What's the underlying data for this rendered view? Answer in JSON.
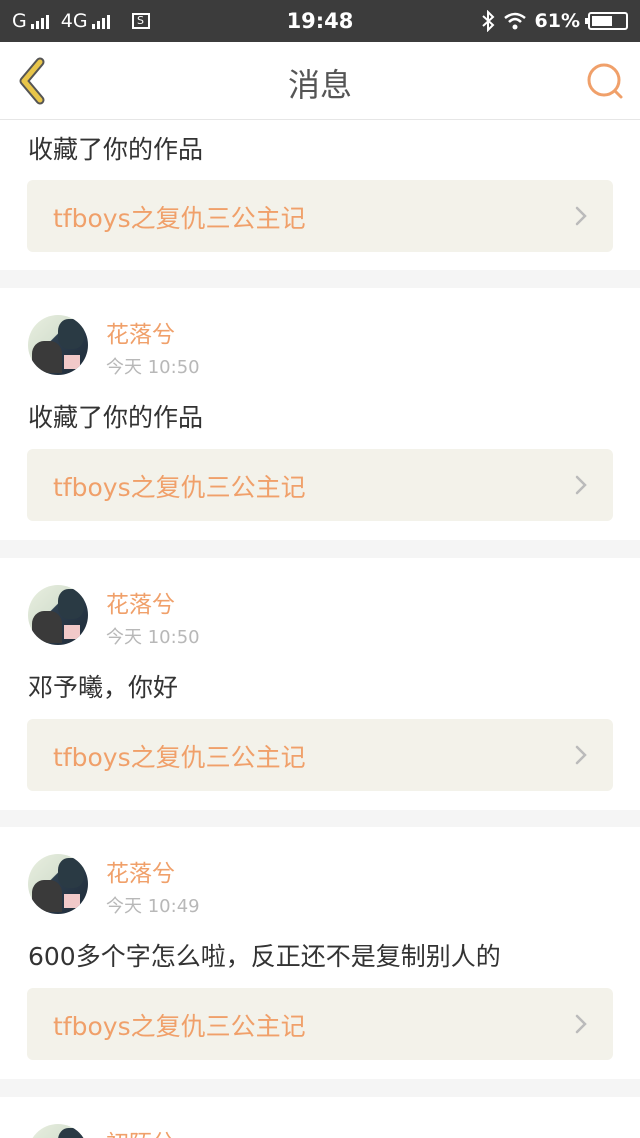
{
  "status_bar": {
    "carrier1": "G",
    "carrier2": "4G",
    "time": "19:48",
    "battery_percent": "61%",
    "battery_level": 0.61,
    "icons": [
      "signal-icon",
      "sim-icon",
      "bluetooth-icon",
      "wifi-icon",
      "battery-icon"
    ]
  },
  "nav": {
    "title": "消息",
    "back_icon": "chevron-left-icon",
    "search_icon": "search-icon"
  },
  "colors": {
    "accent": "#f0a06a",
    "back_icon": "#e8c54a",
    "work_bg": "#f3f2ea",
    "page_bg": "#f5f5f5"
  },
  "messages": [
    {
      "user": "",
      "time": "",
      "text": "收藏了你的作品",
      "work_title": "tfboys之复仇三公主记"
    },
    {
      "user": "花落兮",
      "time": "今天 10:50",
      "text": "收藏了你的作品",
      "work_title": "tfboys之复仇三公主记"
    },
    {
      "user": "花落兮",
      "time": "今天 10:50",
      "text": "邓予曦，你好",
      "work_title": "tfboys之复仇三公主记"
    },
    {
      "user": "花落兮",
      "time": "今天 10:49",
      "text": "600多个字怎么啦，反正还不是复制别人的",
      "work_title": "tfboys之复仇三公主记"
    },
    {
      "user": "初陌兮",
      "time": "",
      "text": "",
      "work_title": ""
    }
  ]
}
